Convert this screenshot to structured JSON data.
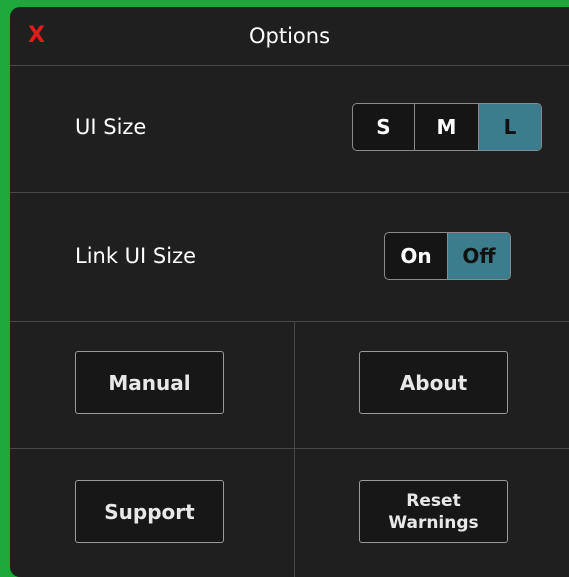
{
  "window": {
    "title": "Options",
    "close_label": "X"
  },
  "ui_size": {
    "label": "UI Size",
    "options": [
      "S",
      "M",
      "L"
    ],
    "selected": "L"
  },
  "link_ui_size": {
    "label": "Link UI Size",
    "options": [
      "On",
      "Off"
    ],
    "selected": "Off"
  },
  "buttons": {
    "manual": "Manual",
    "about": "About",
    "support": "Support",
    "reset_line1": "Reset",
    "reset_line2": "Warnings"
  },
  "colors": {
    "accent": "#3b7d8c",
    "close": "#e21b1b",
    "background_outer": "#1fa83a",
    "panel": "#1f1f1f"
  }
}
